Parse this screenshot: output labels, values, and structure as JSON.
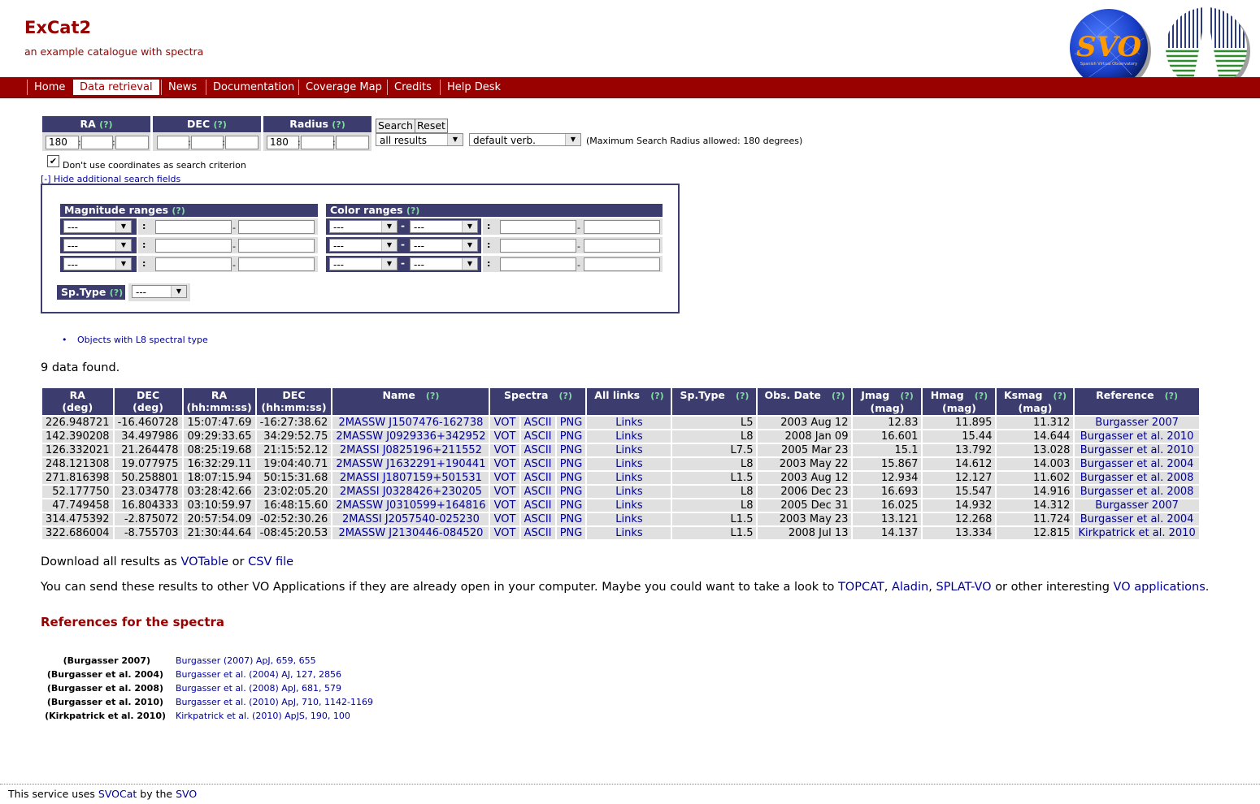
{
  "header": {
    "title": "ExCat2",
    "subtitle": "an example catalogue with spectra",
    "logo_text": "SVO",
    "logo_subtext": "Spanish Virtual Observatory"
  },
  "nav": [
    "Home",
    "Data retrieval",
    "News",
    "Documentation",
    "Coverage Map",
    "Credits",
    "Help Desk"
  ],
  "nav_active": "Data retrieval",
  "search": {
    "help": "(?)",
    "ra_label": "RA",
    "dec_label": "DEC",
    "radius_label": "Radius",
    "ra_value": "180",
    "radius_value": "180",
    "search_button": "Search",
    "reset_button": "Reset",
    "results_select": "all results",
    "verb_select": "default verb.",
    "max_radius_note": "(Maximum Search Radius allowed: 180 degrees)",
    "dont_use_coords": "Don't use coordinates as search criterion",
    "hide_fields_link": "[-] Hide additional search fields",
    "magnitude_ranges": "Magnitude ranges",
    "color_ranges": "Color ranges",
    "sptype_label": "Sp.Type",
    "empty_option": "---",
    "dash": "-",
    "colon": ":"
  },
  "objects_link": "Objects with L8 spectral type",
  "results_count": "9 data found.",
  "table": {
    "headers": [
      {
        "l1": "RA",
        "l2": "(deg)"
      },
      {
        "l1": "DEC",
        "l2": "(deg)"
      },
      {
        "l1": "RA",
        "l2": "(hh:mm:ss)"
      },
      {
        "l1": "DEC",
        "l2": "(hh:mm:ss)"
      },
      {
        "l1": "Name",
        "l2": "",
        "help": "(?)"
      },
      {
        "l1": "Spectra",
        "l2": "",
        "help": "(?)"
      },
      {
        "l1": "All links",
        "l2": "",
        "help": "(?)"
      },
      {
        "l1": "Sp.Type",
        "l2": "",
        "help": "(?)"
      },
      {
        "l1": "Obs. Date",
        "l2": "",
        "help": "(?)"
      },
      {
        "l1": "Jmag",
        "l2": "(mag)",
        "help": "(?)"
      },
      {
        "l1": "Hmag",
        "l2": "(mag)",
        "help": "(?)"
      },
      {
        "l1": "Ksmag",
        "l2": "(mag)",
        "help": "(?)"
      },
      {
        "l1": "Reference",
        "l2": "",
        "help": "(?)"
      }
    ],
    "spectra_links": [
      "VOT",
      "ASCII",
      "PNG"
    ],
    "links_label": "Links",
    "rows": [
      [
        "226.948721",
        "-16.460728",
        "15:07:47.69",
        "-16:27:38.62",
        "2MASSW J1507476-162738",
        "L5",
        "2003 Aug 12",
        "12.83",
        "11.895",
        "11.312",
        "Burgasser 2007"
      ],
      [
        "142.390208",
        "34.497986",
        "09:29:33.65",
        "34:29:52.75",
        "2MASSW J0929336+342952",
        "L8",
        "2008 Jan 09",
        "16.601",
        "15.44",
        "14.644",
        "Burgasser et al. 2010"
      ],
      [
        "126.332021",
        "21.264478",
        "08:25:19.68",
        "21:15:52.12",
        "2MASSI J0825196+211552",
        "L7.5",
        "2005 Mar 23",
        "15.1",
        "13.792",
        "13.028",
        "Burgasser et al. 2010"
      ],
      [
        "248.121308",
        "19.077975",
        "16:32:29.11",
        "19:04:40.71",
        "2MASSW J1632291+190441",
        "L8",
        "2003 May 22",
        "15.867",
        "14.612",
        "14.003",
        "Burgasser et al. 2004"
      ],
      [
        "271.816398",
        "50.258801",
        "18:07:15.94",
        "50:15:31.68",
        "2MASSI J1807159+501531",
        "L1.5",
        "2003 Aug 12",
        "12.934",
        "12.127",
        "11.602",
        "Burgasser et al. 2008"
      ],
      [
        "52.177750",
        "23.034778",
        "03:28:42.66",
        "23:02:05.20",
        "2MASSI J0328426+230205",
        "L8",
        "2006 Dec 23",
        "16.693",
        "15.547",
        "14.916",
        "Burgasser et al. 2008"
      ],
      [
        "47.749458",
        "16.804333",
        "03:10:59.97",
        "16:48:15.60",
        "2MASSW J0310599+164816",
        "L8",
        "2005 Dec 31",
        "16.025",
        "14.932",
        "14.312",
        "Burgasser 2007"
      ],
      [
        "314.475392",
        "-2.875072",
        "20:57:54.09",
        "-02:52:30.26",
        "2MASSI J2057540-025230",
        "L1.5",
        "2003 May 23",
        "13.121",
        "12.268",
        "11.724",
        "Burgasser et al. 2004"
      ],
      [
        "322.686004",
        "-8.755703",
        "21:30:44.64",
        "-08:45:20.53",
        "2MASSW J2130446-084520",
        "L1.5",
        "2008 Jul 13",
        "14.137",
        "13.334",
        "12.815",
        "Kirkpatrick et al. 2010"
      ]
    ]
  },
  "download": {
    "prefix": "Download all results as",
    "votable": "VOTable",
    "or": "or",
    "csv": "CSV file"
  },
  "vo_apps": {
    "text": "You can send these results to other VO Applications if they are already open in your computer. Maybe you could want to take a look to",
    "topcat": "TOPCAT",
    "comma": ",",
    "aladin": "Aladin",
    "splat": "SPLAT-VO",
    "or_other": "or other interesting",
    "vo_applications": "VO applications",
    "period": "."
  },
  "references": {
    "title": "References for the spectra",
    "items": [
      {
        "key": "(Burgasser 2007)",
        "value": "Burgasser (2007) ApJ, 659, 655"
      },
      {
        "key": "(Burgasser et al. 2004)",
        "value": "Burgasser et al. (2004) AJ, 127, 2856"
      },
      {
        "key": "(Burgasser et al. 2008)",
        "value": "Burgasser et al. (2008) ApJ, 681, 579"
      },
      {
        "key": "(Burgasser et al. 2010)",
        "value": "Burgasser et al. (2010) ApJ, 710, 1142-1169"
      },
      {
        "key": "(Kirkpatrick et al. 2010)",
        "value": "Kirkpatrick et al. (2010) ApJS, 190, 100"
      }
    ]
  },
  "footer": {
    "prefix": "This service uses",
    "svocat": "SVOCat",
    "by_the": "by the",
    "svo": "SVO"
  },
  "colors": {
    "brand_red": "#990000",
    "header_navy": "#3c3c6e",
    "link_blue": "#000099",
    "help_green": "#7fdc9f",
    "cell_grey": "#e0e0e0"
  }
}
